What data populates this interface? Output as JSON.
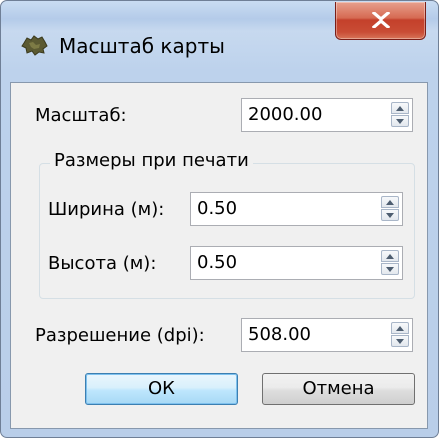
{
  "window": {
    "title": "Масштаб карты",
    "close_glyph": "X",
    "icon": "map-app-icon"
  },
  "scale": {
    "label": "Масштаб:",
    "value": "2000.00"
  },
  "print_size": {
    "group_title": "Размеры при печати",
    "width": {
      "label": "Ширина (м):",
      "value": "0.50"
    },
    "height": {
      "label": "Высота (м):",
      "value": "0.50"
    }
  },
  "resolution": {
    "label": "Разрешение (dpi):",
    "value": "508.00"
  },
  "buttons": {
    "ok": "ОК",
    "cancel": "Отмена"
  },
  "colors": {
    "close_red": "#c94c35",
    "default_button_border": "#3c7fb1",
    "frame_blue": "#b9cee9"
  }
}
